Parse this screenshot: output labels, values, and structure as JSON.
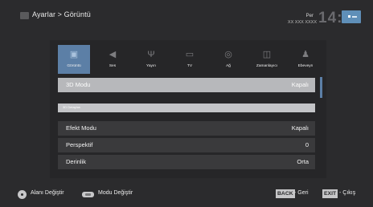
{
  "header": {
    "breadcrumb": "Ayarlar > Görüntü",
    "day": "Per",
    "date": "XX XXX XXXX",
    "time": "14:00"
  },
  "tabs": [
    {
      "label": "Görüntü",
      "icon": "picture-icon",
      "glyph": "▣",
      "active": true
    },
    {
      "label": "Ses",
      "icon": "speaker-icon",
      "glyph": "◀",
      "active": false
    },
    {
      "label": "Yayın",
      "icon": "antenna-icon",
      "glyph": "Ψ",
      "active": false
    },
    {
      "label": "TV",
      "icon": "tv-icon",
      "glyph": "▭",
      "active": false
    },
    {
      "label": "Ağ",
      "icon": "network-icon",
      "glyph": "◎",
      "active": false
    },
    {
      "label": "Zamanlayıcı",
      "icon": "timer-icon",
      "glyph": "◫",
      "active": false
    },
    {
      "label": "Ebeveyn",
      "icon": "parental-icon",
      "glyph": "♟",
      "active": false
    }
  ],
  "settings": {
    "mode3d": {
      "label": "3D Modu",
      "value": "Kapalı"
    },
    "section_label": "3D Detayları",
    "effect": {
      "label": "Efekt Modu",
      "value": "Kapalı"
    },
    "perspective": {
      "label": "Perspektif",
      "value": "0"
    },
    "depth": {
      "label": "Derinlik",
      "value": "Orta"
    }
  },
  "footer": {
    "navigate_label": "Alanı Değiştir",
    "mode_label": "Modu Değiştir",
    "back_key": "BACK",
    "back_label": "- Geri",
    "exit_key": "EXIT",
    "exit_label": "- Çıkış"
  },
  "colors": {
    "accent": "#5c7fa6",
    "selected_row": "#b7b8bb",
    "background": "#2b2b2d"
  }
}
